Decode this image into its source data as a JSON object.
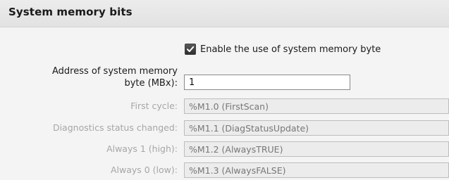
{
  "section": {
    "title": "System memory bits"
  },
  "enable_checkbox": {
    "label": "Enable the use of system memory byte",
    "checked": true
  },
  "address": {
    "label_line1": "Address of system memory",
    "label_line2": "byte (MBx):",
    "value": "1"
  },
  "fields": [
    {
      "label": "First cycle:",
      "value": "%M1.0 (FirstScan)"
    },
    {
      "label": "Diagnostics status changed:",
      "value": "%M1.1 (DiagStatusUpdate)"
    },
    {
      "label": "Always 1 (high):",
      "value": "%M1.2 (AlwaysTRUE)"
    },
    {
      "label": "Always 0 (low):",
      "value": "%M1.3 (AlwaysFALSE)"
    }
  ],
  "icons": {
    "checkbox": "checkmark-icon"
  }
}
